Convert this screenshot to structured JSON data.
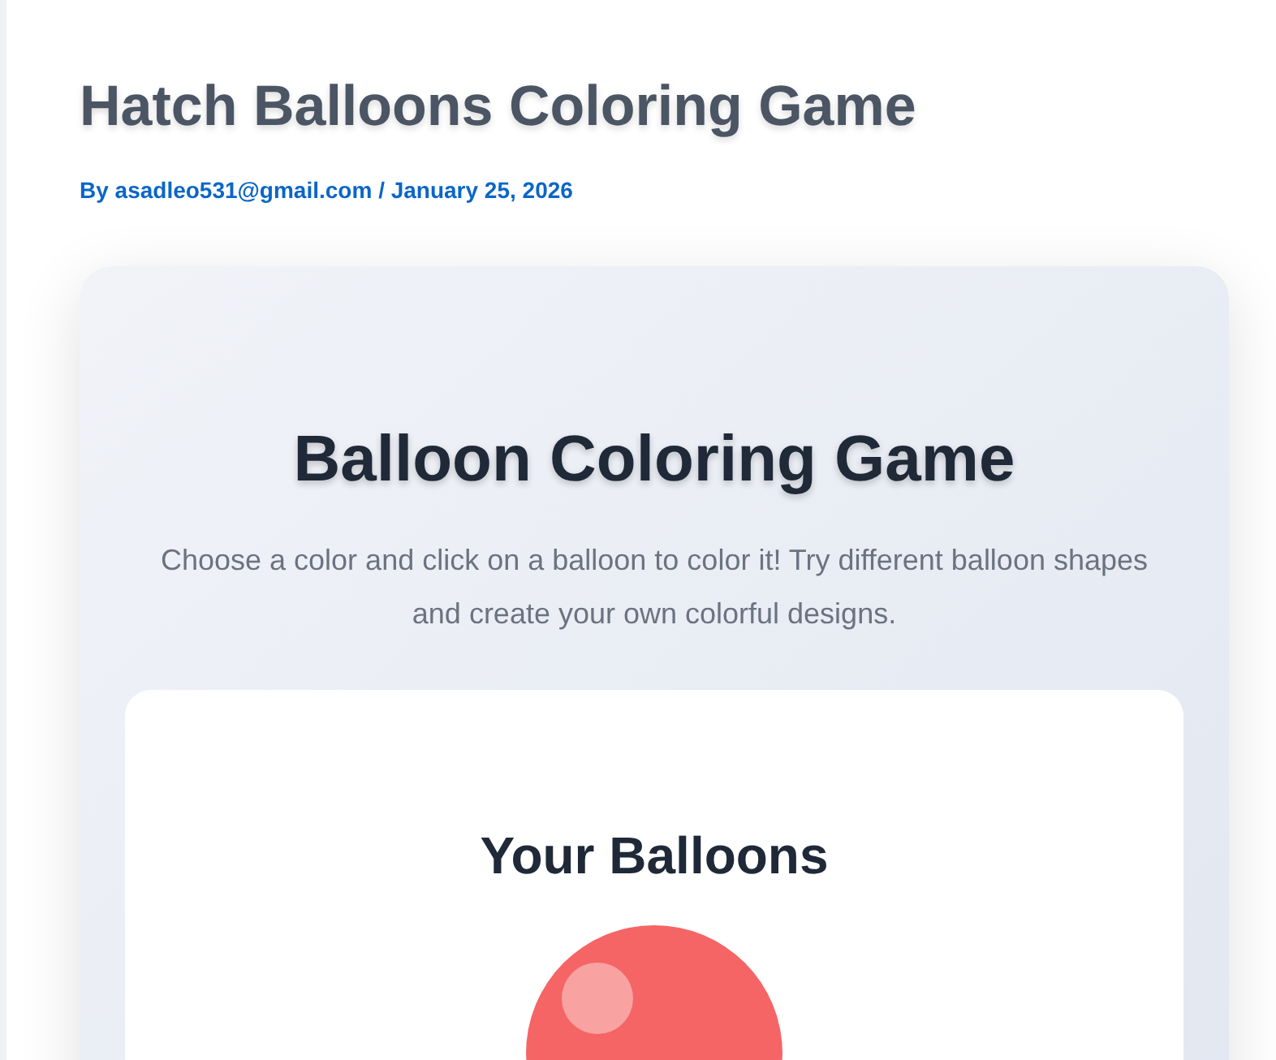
{
  "post": {
    "title": "Hatch Balloons Coloring Game",
    "byline": "By asadleo531@gmail.com / January 25, 2026"
  },
  "game": {
    "heading": "Balloon Coloring Game",
    "intro": "Choose a color and click on a balloon to color it! Try different balloon shapes and create your own colorful designs.",
    "panel": {
      "heading": "Your Balloons",
      "balloons": [
        {
          "color": "#f56565"
        }
      ]
    }
  }
}
